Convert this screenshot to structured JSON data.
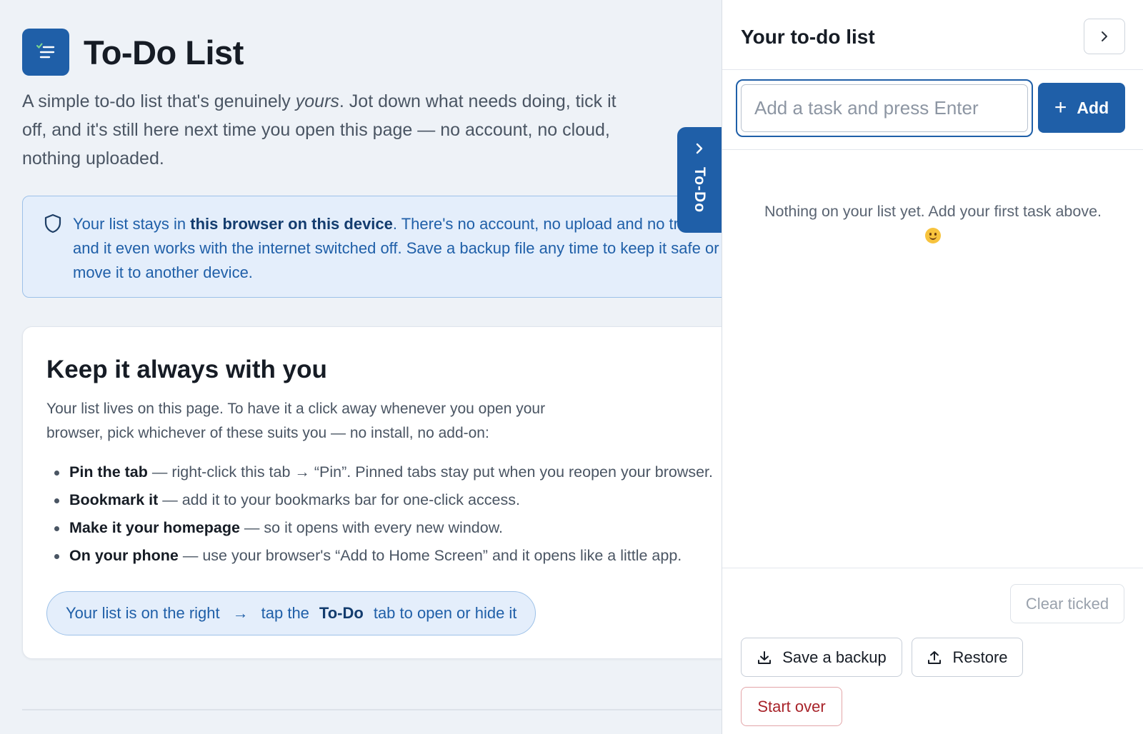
{
  "app": {
    "title": "To-Do List",
    "intro_part1": "A simple to-do list that's genuinely ",
    "intro_emphasis": "yours",
    "intro_part2": ". Jot down what needs doing, tick it off, and it's still here next time you open this page — no account, no cloud, nothing uploaded."
  },
  "notice": {
    "text_before": "Your list stays in ",
    "text_strong": "this browser on this device",
    "text_after": ". There's no account, no upload and no tracking, and it even works with the internet switched off. Save a backup file any time to keep it safe or move it to another device."
  },
  "card": {
    "title": "Keep it always with you",
    "description": "Your list lives on this page. To have it a click away whenever you open your browser, pick whichever of these suits you — no install, no add-on:",
    "tips": [
      {
        "label": "Pin the tab",
        "text": " — right-click this tab → “Pin”. Pinned tabs stay put when you reopen your browser."
      },
      {
        "label": "Bookmark it",
        "text": " — add it to your bookmarks bar for one-click access."
      },
      {
        "label": "Make it your homepage",
        "text": " — so it opens with every new window."
      },
      {
        "label": "On your phone",
        "text": " — use your browser's “Add to Home Screen” and it opens like a little app."
      }
    ],
    "hint": {
      "part1": "Your list is on the right",
      "arrow": "→",
      "part2": "tap the",
      "key": "To-Do",
      "part3": "tab to open or hide it"
    }
  },
  "side_tab": {
    "label": "To-Do",
    "icon": "chevron-right-icon"
  },
  "panel": {
    "title": "Your to-do list",
    "close_icon": "chevron-right-icon",
    "input": {
      "placeholder": "Add a task and press Enter",
      "value": ""
    },
    "add_button": {
      "icon": "plus",
      "label": "Add"
    },
    "empty_text": "Nothing on your list yet. Add your first task above.",
    "empty_emoji": "smiley",
    "buttons": {
      "clear_ticked": "Clear ticked",
      "save_backup": "Save a backup",
      "restore": "Restore",
      "start_over": "Start over"
    }
  },
  "colors": {
    "accent": "#1f5fa8",
    "notice_bg": "#e4eefb",
    "danger": "#a8232a",
    "page_bg": "#eef2f7"
  }
}
